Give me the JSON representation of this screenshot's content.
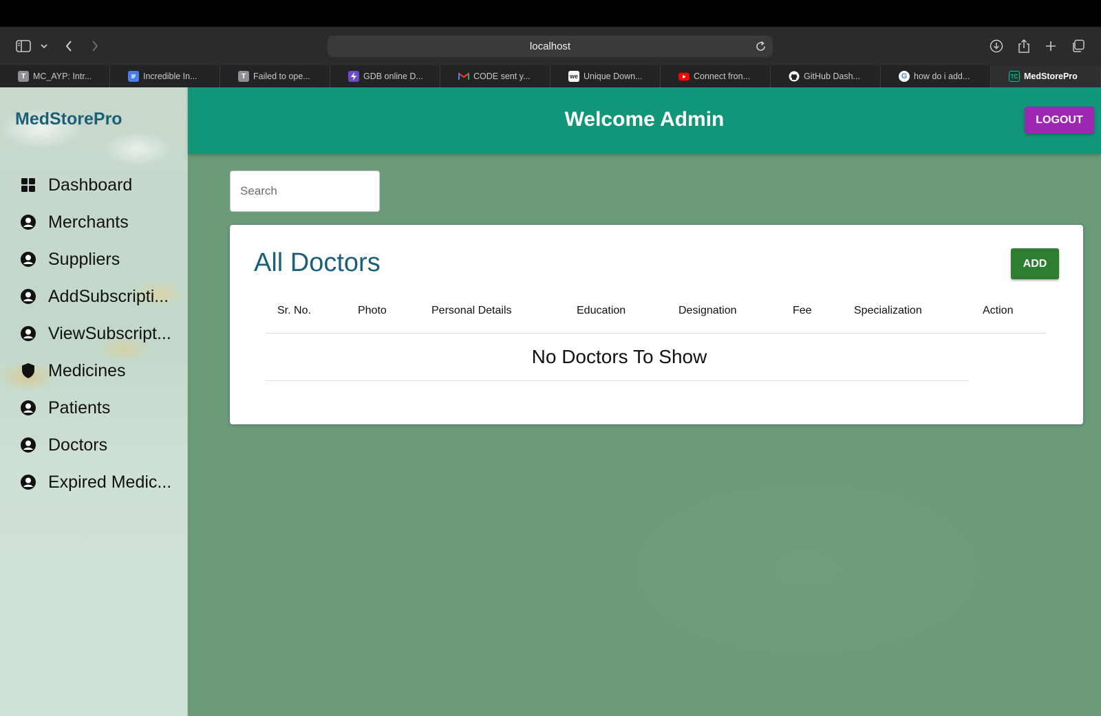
{
  "browser": {
    "url": "localhost",
    "tabs": [
      {
        "label": "MC_AYP: Intr...",
        "icon": "t-letter-icon",
        "color": "#8e8e93"
      },
      {
        "label": "Incredible In...",
        "icon": "docs-icon",
        "color": "#4a7ee6"
      },
      {
        "label": "Failed to ope...",
        "icon": "t-letter-icon",
        "color": "#8e8e93"
      },
      {
        "label": "GDB online D...",
        "icon": "lightning-icon",
        "color": "#6a4cc4"
      },
      {
        "label": "CODE sent y...",
        "icon": "gmail-icon",
        "color": "#d44638"
      },
      {
        "label": "Unique Down...",
        "icon": "we-icon",
        "color": "#ffffff"
      },
      {
        "label": "Connect fron...",
        "icon": "youtube-icon",
        "color": "#ff0000"
      },
      {
        "label": "GitHub Dash...",
        "icon": "github-icon",
        "color": "#ffffff"
      },
      {
        "label": "how do i add...",
        "icon": "google-icon",
        "color": "#4285f4"
      },
      {
        "label": "MedStorePro",
        "icon": "tc-icon",
        "color": "#12967a"
      }
    ]
  },
  "sidebar": {
    "brand": "MedStorePro",
    "items": [
      {
        "label": "Dashboard",
        "icon": "dashboard-grid-icon"
      },
      {
        "label": "Merchants",
        "icon": "user-circle-icon"
      },
      {
        "label": "Suppliers",
        "icon": "user-circle-icon"
      },
      {
        "label": "AddSubscripti...",
        "icon": "user-circle-icon"
      },
      {
        "label": "ViewSubscript...",
        "icon": "user-circle-icon"
      },
      {
        "label": "Medicines",
        "icon": "shield-icon"
      },
      {
        "label": "Patients",
        "icon": "user-circle-icon"
      },
      {
        "label": "Doctors",
        "icon": "user-circle-icon"
      },
      {
        "label": "Expired Medic...",
        "icon": "user-circle-icon"
      }
    ]
  },
  "header": {
    "title": "Welcome Admin",
    "logout_label": "LOGOUT"
  },
  "search": {
    "placeholder": "Search",
    "value": ""
  },
  "doctors": {
    "title": "All Doctors",
    "add_label": "ADD",
    "columns": [
      "Sr. No.",
      "Photo",
      "Personal Details",
      "Education",
      "Designation",
      "Fee",
      "Specialization",
      "Action"
    ],
    "empty_message": "No Doctors To Show"
  },
  "colors": {
    "header": "#12967a",
    "logout": "#9c27b0",
    "add": "#2e7d32",
    "brand_text": "#1c5f78"
  }
}
